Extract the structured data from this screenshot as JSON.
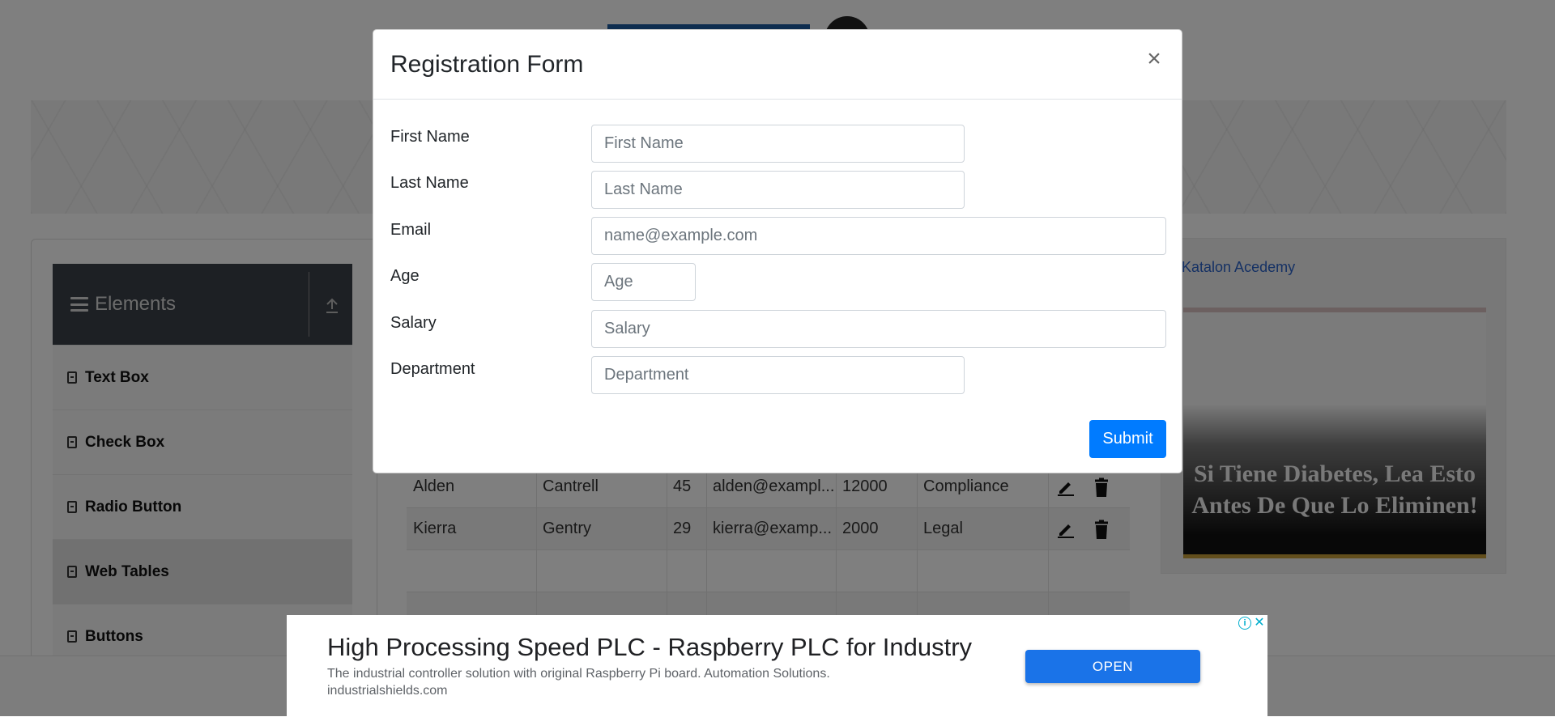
{
  "sidebar": {
    "header": "Elements",
    "items": [
      "Text Box",
      "Check Box",
      "Radio Button",
      "Web Tables",
      "Buttons"
    ],
    "active_item": "Web Tables"
  },
  "table": {
    "rows": [
      {
        "first": "Alden",
        "last": "Cantrell",
        "age": "45",
        "email": "alden@exampl...",
        "salary": "12000",
        "department": "Compliance"
      },
      {
        "first": "Kierra",
        "last": "Gentry",
        "age": "29",
        "email": "kierra@examp...",
        "salary": "2000",
        "department": "Legal"
      }
    ]
  },
  "side_ad": {
    "image_alt": "Katalon Acedemy",
    "headline": "Si Tiene Diabetes, Lea Esto Antes De Que Lo Eliminen!"
  },
  "modal": {
    "title": "Registration Form",
    "close": "×",
    "fields": {
      "first_name": {
        "label": "First Name",
        "placeholder": "First Name",
        "value": ""
      },
      "last_name": {
        "label": "Last Name",
        "placeholder": "Last Name",
        "value": ""
      },
      "email": {
        "label": "Email",
        "placeholder": "name@example.com",
        "value": ""
      },
      "age": {
        "label": "Age",
        "placeholder": "Age",
        "value": ""
      },
      "salary": {
        "label": "Salary",
        "placeholder": "Salary",
        "value": ""
      },
      "department": {
        "label": "Department",
        "placeholder": "Department",
        "value": ""
      }
    },
    "submit": "Submit"
  },
  "bottom_ad": {
    "title": "High Processing Speed PLC - Raspberry PLC for Industry",
    "description": "The industrial controller solution with original Raspberry Pi board. Automation Solutions.",
    "domain": "industrialshields.com",
    "cta": "OPEN",
    "info_glyph": "i",
    "close_glyph": "✕"
  },
  "colors": {
    "primary": "#007bff",
    "sidebar_header": "#3a4149",
    "ad_cta": "#1a73e8",
    "adchoices": "#00aecd"
  }
}
